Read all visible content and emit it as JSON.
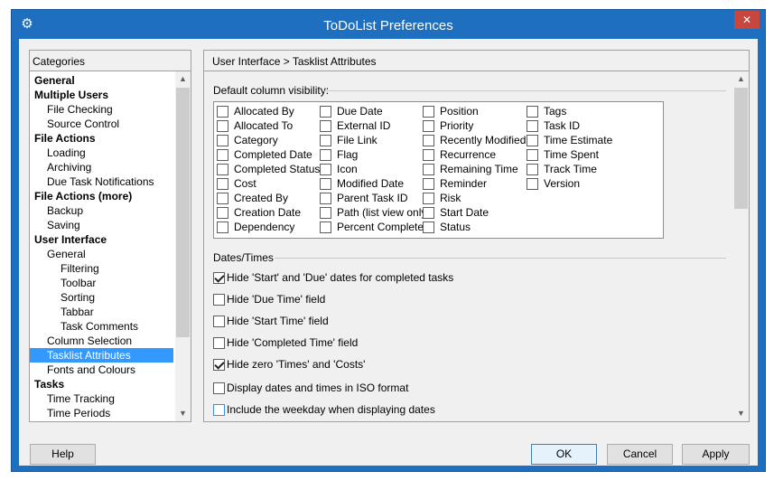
{
  "window": {
    "title": "ToDoList Preferences",
    "close_glyph": "✕",
    "icon": "gear-icon"
  },
  "categories": {
    "header": "Categories",
    "items": [
      {
        "label": "General",
        "level": 0,
        "bold": true
      },
      {
        "label": "Multiple Users",
        "level": 0,
        "bold": true
      },
      {
        "label": "File Checking",
        "level": 1
      },
      {
        "label": "Source Control",
        "level": 1
      },
      {
        "label": "File Actions",
        "level": 0,
        "bold": true
      },
      {
        "label": "Loading",
        "level": 1
      },
      {
        "label": "Archiving",
        "level": 1
      },
      {
        "label": "Due Task Notifications",
        "level": 1
      },
      {
        "label": "File Actions (more)",
        "level": 0,
        "bold": true
      },
      {
        "label": "Backup",
        "level": 1
      },
      {
        "label": "Saving",
        "level": 1
      },
      {
        "label": "User Interface",
        "level": 0,
        "bold": true
      },
      {
        "label": "General",
        "level": 1
      },
      {
        "label": "Filtering",
        "level": 2
      },
      {
        "label": "Toolbar",
        "level": 2
      },
      {
        "label": "Sorting",
        "level": 2
      },
      {
        "label": "Tabbar",
        "level": 2
      },
      {
        "label": "Task Comments",
        "level": 2
      },
      {
        "label": "Column Selection",
        "level": 1
      },
      {
        "label": "Tasklist Attributes",
        "level": 1,
        "selected": true
      },
      {
        "label": "Fonts and Colours",
        "level": 1
      },
      {
        "label": "Tasks",
        "level": 0,
        "bold": true
      },
      {
        "label": "Time Tracking",
        "level": 1
      },
      {
        "label": "Time Periods",
        "level": 1
      }
    ]
  },
  "panel": {
    "breadcrumb": "User Interface > Tasklist Attributes",
    "column_visibility_label": "Default column visibility:",
    "columns": [
      [
        {
          "label": "Allocated By",
          "checked": false
        },
        {
          "label": "Allocated To",
          "checked": false
        },
        {
          "label": "Category",
          "checked": false
        },
        {
          "label": "Completed Date",
          "checked": false
        },
        {
          "label": "Completed Status",
          "checked": false
        },
        {
          "label": "Cost",
          "checked": false
        },
        {
          "label": "Created By",
          "checked": false
        },
        {
          "label": "Creation Date",
          "checked": false
        },
        {
          "label": "Dependency",
          "checked": false
        }
      ],
      [
        {
          "label": "Due Date",
          "checked": false
        },
        {
          "label": "External ID",
          "checked": false
        },
        {
          "label": "File Link",
          "checked": false
        },
        {
          "label": "Flag",
          "checked": false
        },
        {
          "label": "Icon",
          "checked": false
        },
        {
          "label": "Modified Date",
          "checked": false
        },
        {
          "label": "Parent Task ID",
          "checked": false
        },
        {
          "label": "Path (list view only)",
          "checked": false
        },
        {
          "label": "Percent Complete",
          "checked": false
        }
      ],
      [
        {
          "label": "Position",
          "checked": false
        },
        {
          "label": "Priority",
          "checked": false
        },
        {
          "label": "Recently Modified",
          "checked": false
        },
        {
          "label": "Recurrence",
          "checked": false
        },
        {
          "label": "Remaining Time",
          "checked": false
        },
        {
          "label": "Reminder",
          "checked": false
        },
        {
          "label": "Risk",
          "checked": false
        },
        {
          "label": "Start Date",
          "checked": false
        },
        {
          "label": "Status",
          "checked": false
        }
      ],
      [
        {
          "label": "Tags",
          "checked": false
        },
        {
          "label": "Task ID",
          "checked": false
        },
        {
          "label": "Time Estimate",
          "checked": false
        },
        {
          "label": "Time Spent",
          "checked": false
        },
        {
          "label": "Track Time",
          "checked": false
        },
        {
          "label": "Version",
          "checked": false
        }
      ]
    ],
    "dates_label": "Dates/Times",
    "date_options": [
      {
        "label": "Hide 'Start' and 'Due' dates for completed tasks",
        "checked": true
      },
      {
        "label": "Hide 'Due Time' field",
        "checked": false
      },
      {
        "label": "Hide 'Start Time' field",
        "checked": false
      },
      {
        "label": "Hide 'Completed Time' field",
        "checked": false
      },
      {
        "label": "Hide zero 'Times' and 'Costs'",
        "checked": true
      },
      {
        "label": "Display dates and times in ISO format",
        "checked": false
      },
      {
        "label": "Include the weekday when displaying dates",
        "checked": false,
        "focused": true
      }
    ]
  },
  "buttons": {
    "help": "Help",
    "ok": "OK",
    "cancel": "Cancel",
    "apply": "Apply"
  },
  "colors": {
    "titlebar": "#1e6fbf",
    "selection": "#3399ff",
    "close": "#c7463d"
  }
}
